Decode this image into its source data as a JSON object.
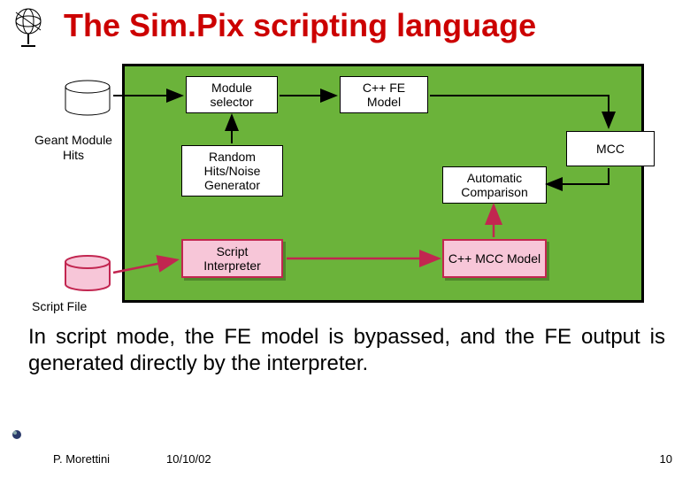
{
  "title": "The Sim.Pix scripting language",
  "labels": {
    "geant_hits": "Geant Module Hits",
    "script_file": "Script File"
  },
  "boxes": {
    "module_selector": "Module selector",
    "cpp_fe_model": "C++ FE Model",
    "random_gen": "Random Hits/Noise Generator",
    "mcc": "MCC",
    "auto_compare": "Automatic Comparison",
    "script_interp": "Script Interpreter",
    "cpp_mcc_model": "C++ MCC Model"
  },
  "body": "In script mode, the FE model is bypassed, and the FE output is generated directly by the interpreter.",
  "footer": {
    "author": "P. Morettini",
    "date": "10/10/02",
    "page": "10"
  }
}
